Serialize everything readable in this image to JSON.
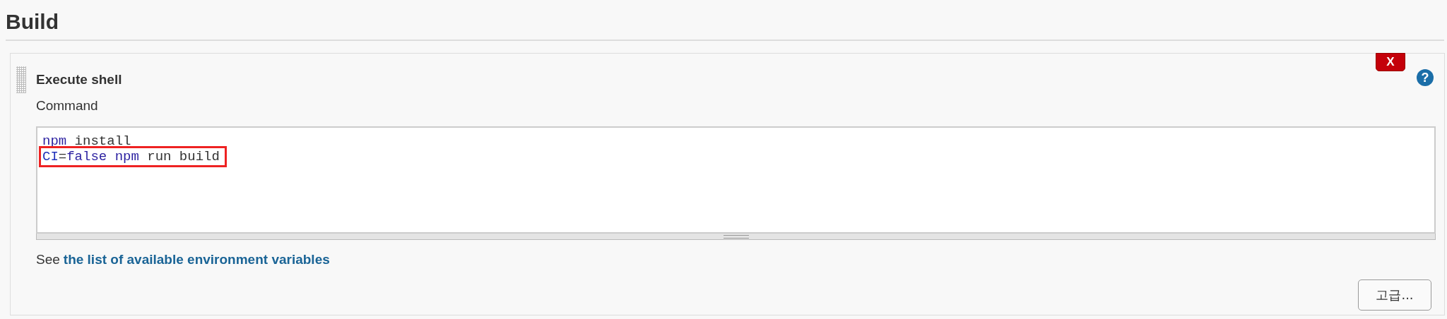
{
  "section": {
    "title": "Build"
  },
  "step": {
    "title": "Execute shell",
    "delete_label": "X",
    "help_label": "?",
    "field_label": "Command",
    "command_lines": [
      {
        "highlighted": false,
        "tokens": [
          {
            "text": "npm",
            "kind": "keyword"
          },
          {
            "text": " install",
            "kind": "plain"
          }
        ]
      },
      {
        "highlighted": true,
        "tokens": [
          {
            "text": "CI",
            "kind": "variable"
          },
          {
            "text": "=",
            "kind": "plain"
          },
          {
            "text": "false",
            "kind": "keyword"
          },
          {
            "text": " npm",
            "kind": "keyword"
          },
          {
            "text": " run build",
            "kind": "plain"
          }
        ]
      }
    ],
    "hint_prefix": "See",
    "hint_link": "the list of available environment variables",
    "advanced_button": "고급..."
  }
}
